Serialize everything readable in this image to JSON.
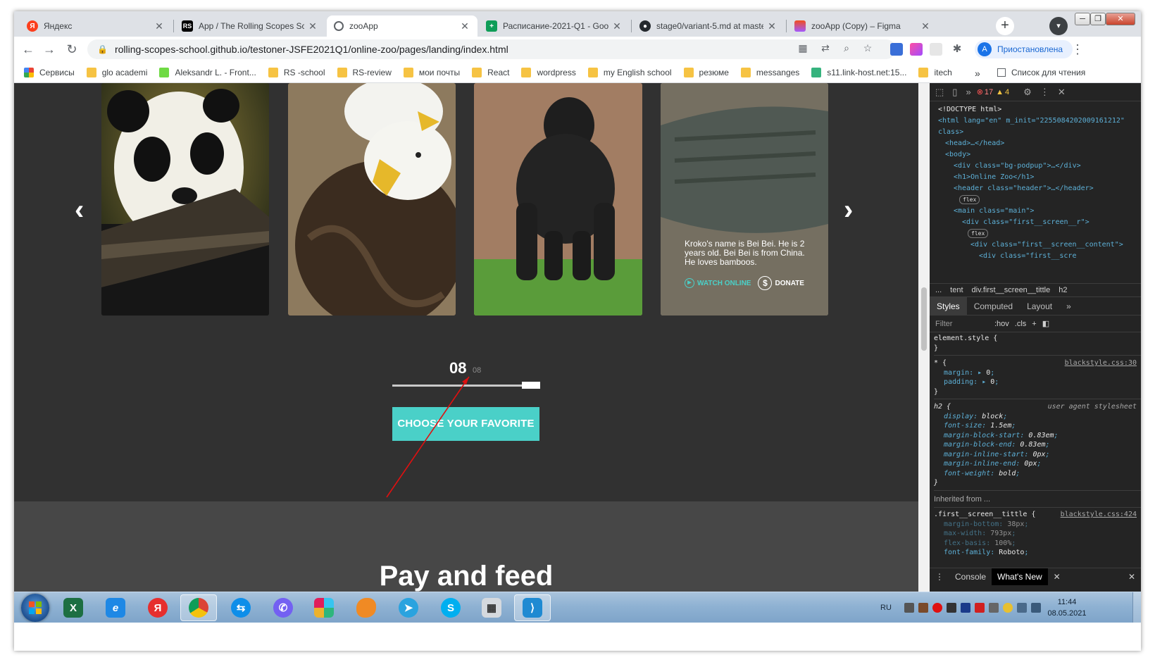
{
  "browser": {
    "tabs": [
      {
        "title": "Яндекс",
        "icon": "yandex-icon",
        "color": "#fc3f1d"
      },
      {
        "title": "App / The Rolling Scopes Scho",
        "icon": "rs-icon",
        "color": "#000000"
      },
      {
        "title": "zooApp",
        "icon": "globe-icon",
        "color": "#5f6368",
        "active": true
      },
      {
        "title": "Расписание-2021-Q1 - Googl",
        "icon": "google-sheets-icon",
        "color": "#0f9d58"
      },
      {
        "title": "stage0/variant-5.md at master",
        "icon": "github-icon",
        "color": "#24292e"
      },
      {
        "title": "zooApp (Copy) – Figma",
        "icon": "figma-icon",
        "color": "#f24e1e"
      }
    ],
    "new_tab": "+",
    "url": "rolling-scopes-school.github.io/testoner-JSFE2021Q1/online-zoo/pages/landing/index.html",
    "profile_status": "Приостановлена",
    "profile_initial": "A",
    "bookmarks": [
      {
        "label": "Сервисы",
        "icon": "apps-grid-icon"
      },
      {
        "label": "glo academi",
        "icon": "folder-icon"
      },
      {
        "label": "Aleksandr L. - Front...",
        "icon": "upwork-icon"
      },
      {
        "label": "RS -school",
        "icon": "folder-icon"
      },
      {
        "label": "RS-review",
        "icon": "folder-icon"
      },
      {
        "label": "мои почты",
        "icon": "folder-icon"
      },
      {
        "label": "React",
        "icon": "folder-icon"
      },
      {
        "label": "wordpress",
        "icon": "folder-icon"
      },
      {
        "label": "my English school",
        "icon": "folder-icon"
      },
      {
        "label": "резюме",
        "icon": "folder-icon"
      },
      {
        "label": "messanges",
        "icon": "folder-icon"
      },
      {
        "label": "s11.link-host.net:15...",
        "icon": "link-host-icon"
      },
      {
        "label": "itech",
        "icon": "folder-icon"
      }
    ],
    "bookmarks_more": "»",
    "reading_list": "Список для чтения"
  },
  "page": {
    "carousel": {
      "card_text": "Kroko's name is Bei Bei. He is 2 years old. Bei Bei is from China. He loves bamboos.",
      "watch_label": "WATCH ONLINE",
      "donate_label": "DONATE",
      "dollar_symbol": "$",
      "prev_arrow": "‹",
      "next_arrow": "›"
    },
    "slider": {
      "current": "08",
      "total": "08",
      "progress": 1.0
    },
    "cta_label": "CHOOSE YOUR FAVORITE",
    "pay_title": "Pay and feed",
    "colors": {
      "accent": "#4ad0c8",
      "background": "#313131",
      "section": "#474747"
    }
  },
  "devtools": {
    "errors": "17",
    "warnings": "4",
    "dom_lines": [
      "<!DOCTYPE html>",
      "<html lang=\"en\" m_init=\"2255084202009161212\" class>",
      "<head>…</head>",
      "<body>",
      "<div class=\"bg-podpup\">…</div>",
      "<h1>Online Zoo</h1>",
      "<header class=\"header\">…</header>",
      "flex",
      "<main class=\"main\">",
      "<div class=\"first__screen__r\">",
      "flex",
      "<div class=\"first__screen__content\">",
      "<div class=\"first__scre"
    ],
    "breadcrumbs": [
      "...",
      "tent",
      "div.first__screen__tittle",
      "h2"
    ],
    "tabs": [
      "Styles",
      "Computed",
      "Layout",
      "»"
    ],
    "filter_placeholder": "Filter",
    "hov": ":hov",
    "cls": ".cls",
    "rules": {
      "element_style": "element.style {",
      "star_selector": "* {",
      "star_source": "blackstyle.css:30",
      "star_props": [
        [
          "margin",
          "0"
        ],
        [
          "padding",
          "0"
        ]
      ],
      "h2_selector": "h2 {",
      "h2_source": "user agent stylesheet",
      "h2_props": [
        [
          "display",
          "block"
        ],
        [
          "font-size",
          "1.5em"
        ],
        [
          "margin-block-start",
          "0.83em"
        ],
        [
          "margin-block-end",
          "0.83em"
        ],
        [
          "margin-inline-start",
          "0px"
        ],
        [
          "margin-inline-end",
          "0px"
        ],
        [
          "font-weight",
          "bold"
        ]
      ],
      "inherited_from": "Inherited from ...",
      "first_selector": ".first__screen__tittle {",
      "first_source": "blackstyle.css:424",
      "first_props": [
        [
          "margin-bottom",
          "38px"
        ],
        [
          "max-width",
          "793px"
        ],
        [
          "flex-basis",
          "100%"
        ],
        [
          "font-family",
          "Roboto"
        ]
      ],
      "closing": "}"
    },
    "drawer": [
      "Console",
      "What's New"
    ]
  },
  "taskbar": {
    "apps": [
      "excel-icon",
      "internet-explorer-icon",
      "yandex-browser-icon",
      "chrome-icon",
      "teamviewer-icon",
      "viber-icon",
      "slack-icon",
      "goldfish-icon",
      "telegram-icon",
      "skype-icon",
      "calculator-icon",
      "vscode-icon"
    ],
    "lang": "RU",
    "time": "11:44",
    "date": "08.05.2021"
  }
}
